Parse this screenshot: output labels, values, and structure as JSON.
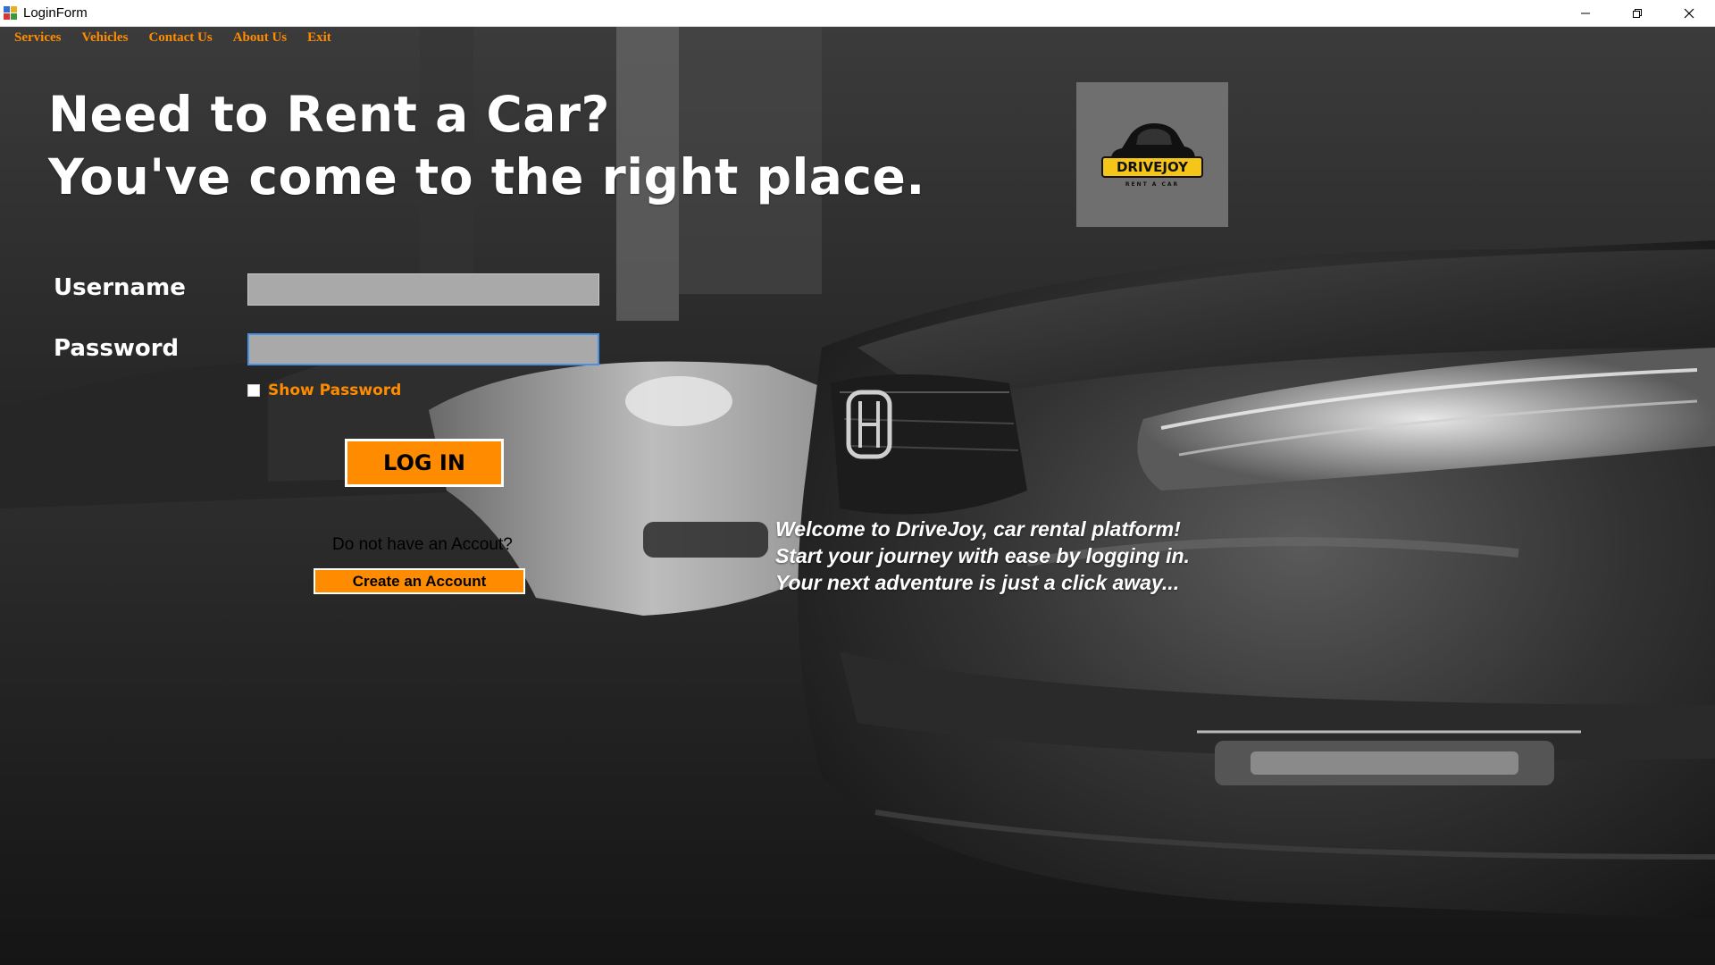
{
  "window": {
    "title": "LoginForm"
  },
  "menu": {
    "items": [
      "Services",
      "Vehicles",
      "Contact Us",
      "About Us",
      "Exit"
    ]
  },
  "headline": {
    "line1": "Need to Rent a Car?",
    "line2": "You've come to the right place."
  },
  "logo": {
    "brand": "DRIVEJOY",
    "tagline": "RENT A CAR"
  },
  "form": {
    "username_label": "Username",
    "username_value": "",
    "password_label": "Password",
    "password_value": "",
    "show_password_label": "Show Password",
    "show_password_checked": false,
    "login_label": "LOG IN",
    "no_account_text": "Do not have an Accout?",
    "create_account_label": "Create an Account"
  },
  "welcome": {
    "line1": "Welcome to DriveJoy, car rental platform!",
    "line2": "Start your journey with ease by logging in.",
    "line3": "Your next adventure is just a click away..."
  },
  "colors": {
    "accent": "#ff8c00",
    "logo_bg": "#6f6f6f",
    "logo_yellow": "#f5c518",
    "input_bg": "#a9a9a9"
  }
}
